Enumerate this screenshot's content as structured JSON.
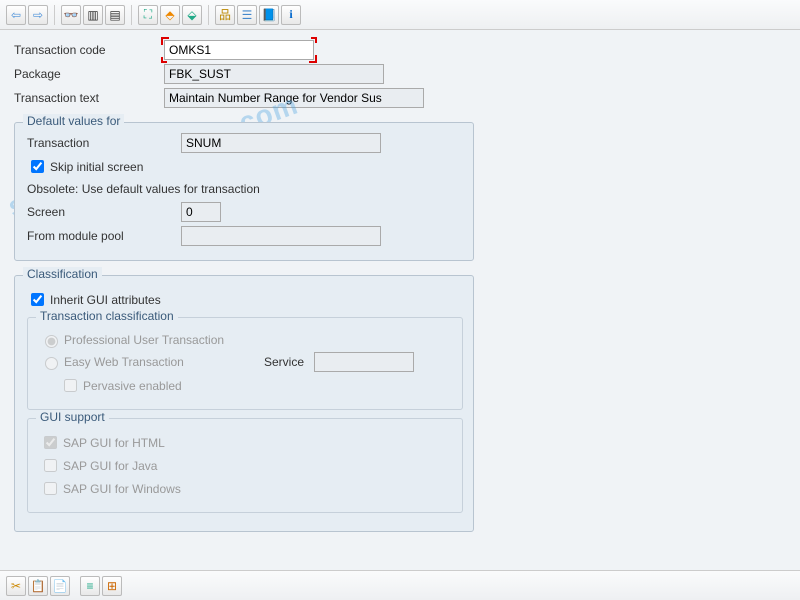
{
  "toolbar": {
    "back_icon": "⇦",
    "forward_icon": "⇨",
    "glasses_icon": "👓",
    "display_icon": "▥",
    "list_icon": "▤",
    "tool1_icon": "⛶",
    "tool2_icon": "⬘",
    "tool3_icon": "⬙",
    "hier_icon": "品",
    "tree_icon": "☰",
    "book_icon": "📘",
    "info_icon": "i"
  },
  "header": {
    "tcode_label": "Transaction code",
    "tcode_value": "OMKS1",
    "package_label": "Package",
    "package_value": "FBK_SUST",
    "ttext_label": "Transaction text",
    "ttext_value": "Maintain Number Range for Vendor Sus"
  },
  "group_defaults": {
    "title": "Default values for",
    "transaction_label": "Transaction",
    "transaction_value": "SNUM",
    "skip_initial_label": "Skip initial screen",
    "skip_initial_checked": true,
    "obsolete_text": "Obsolete: Use default values for transaction",
    "screen_label": "Screen",
    "screen_value": "0",
    "from_module_label": "From module pool",
    "from_module_value": ""
  },
  "group_class": {
    "title": "Classification",
    "inherit_label": "Inherit GUI attributes",
    "inherit_checked": true,
    "trans_class_title": "Transaction classification",
    "radio_professional": "Professional User Transaction",
    "radio_easy": "Easy Web Transaction",
    "service_label": "Service",
    "service_value": "",
    "pervasive_label": "Pervasive enabled",
    "gui_support_title": "GUI support",
    "gui_html": "SAP GUI for HTML",
    "gui_html_checked": true,
    "gui_java": "SAP GUI for Java",
    "gui_java_checked": false,
    "gui_windows": "SAP GUI for Windows",
    "gui_windows_checked": false
  },
  "bottom": {
    "cut_icon": "✂",
    "copy_icon": "📋",
    "paste_icon": "📄",
    "sel1_icon": "≡",
    "sel2_icon": "⊞"
  },
  "watermark": "saptables-online.com",
  "colors": {
    "accent": "#3a5a7a",
    "highlight": "#d00",
    "panel": "#e6edf3"
  }
}
